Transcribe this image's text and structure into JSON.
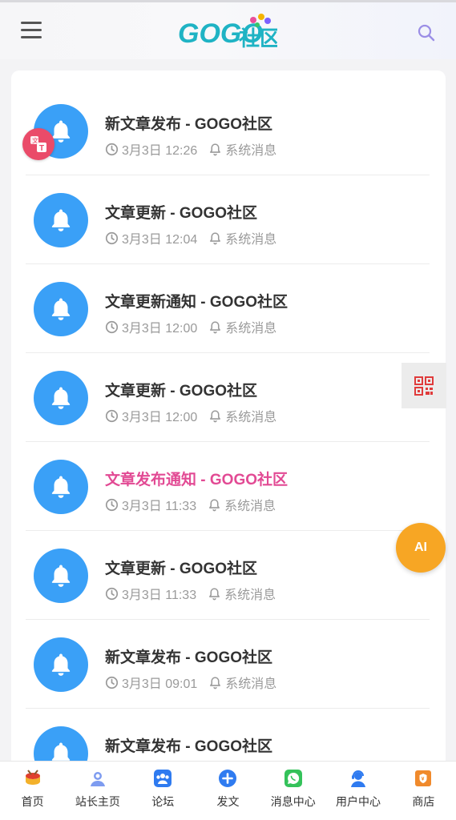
{
  "header": {
    "logo_text": "GOGO社区",
    "menu_icon": "hamburger-icon",
    "search_icon": "search-icon"
  },
  "notifications": [
    {
      "title": "新文章发布 - GOGO社区",
      "time": "3月3日 12:26",
      "type": "系统消息",
      "highlight": false
    },
    {
      "title": "文章更新 - GOGO社区",
      "time": "3月3日 12:04",
      "type": "系统消息",
      "highlight": false
    },
    {
      "title": "文章更新通知 - GOGO社区",
      "time": "3月3日 12:00",
      "type": "系统消息",
      "highlight": false
    },
    {
      "title": "文章更新 - GOGO社区",
      "time": "3月3日 12:00",
      "type": "系统消息",
      "highlight": false
    },
    {
      "title": "文章发布通知 - GOGO社区",
      "time": "3月3日 11:33",
      "type": "系统消息",
      "highlight": true
    },
    {
      "title": "文章更新 - GOGO社区",
      "time": "3月3日 11:33",
      "type": "系统消息",
      "highlight": false
    },
    {
      "title": "新文章发布 - GOGO社区",
      "time": "3月3日 09:01",
      "type": "系统消息",
      "highlight": false
    },
    {
      "title": "新文章发布 - GOGO社区",
      "time": "",
      "type": "",
      "highlight": false
    }
  ],
  "floating": {
    "ai_label": "AI",
    "qr_icon": "qr-code-icon",
    "translate_icon": "translate-icon"
  },
  "bottom_nav": [
    {
      "label": "首页",
      "icon": "drum-icon"
    },
    {
      "label": "站长主页",
      "icon": "user-avatar-icon"
    },
    {
      "label": "论坛",
      "icon": "group-icon"
    },
    {
      "label": "发文",
      "icon": "plus-circle-icon"
    },
    {
      "label": "消息中心",
      "icon": "chat-icon"
    },
    {
      "label": "用户中心",
      "icon": "support-agent-icon"
    },
    {
      "label": "商店",
      "icon": "shop-icon"
    }
  ],
  "colors": {
    "avatar_blue": "#3aa0f7",
    "highlight_pink": "#e24a94",
    "ai_orange": "#f7a624",
    "badge_red": "#ea4b69"
  }
}
